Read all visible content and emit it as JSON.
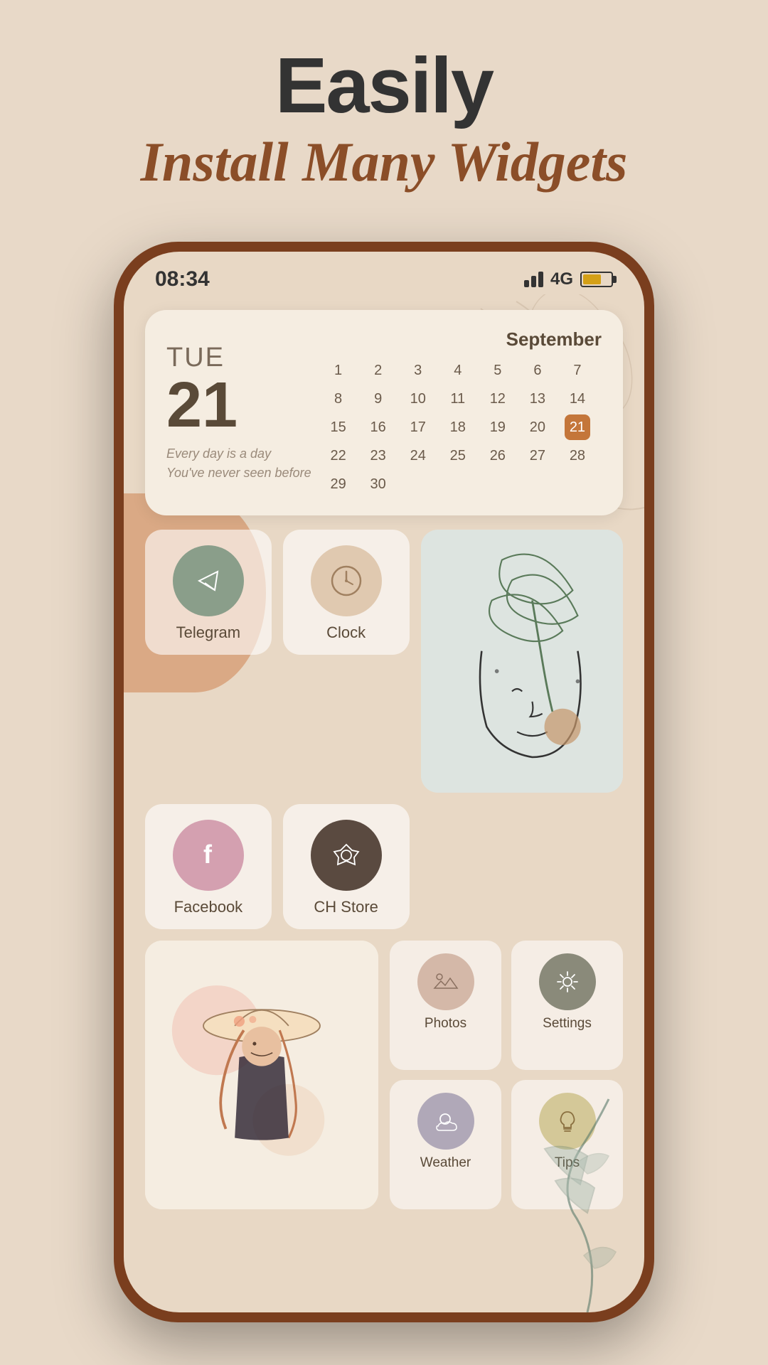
{
  "header": {
    "easily_label": "Easily",
    "subtitle_label": "Install Many Widgets"
  },
  "status_bar": {
    "time": "08:34",
    "network": "4G"
  },
  "calendar_widget": {
    "day_name": "TUE",
    "day_number": "21",
    "month": "September",
    "quote_line1": "Every day is a day",
    "quote_line2": "You've never seen before",
    "today_date": 21,
    "days": [
      {
        "label": "1"
      },
      {
        "label": "2"
      },
      {
        "label": "3"
      },
      {
        "label": "4"
      },
      {
        "label": "5"
      },
      {
        "label": "6"
      },
      {
        "label": "7"
      },
      {
        "label": "8"
      },
      {
        "label": "9"
      },
      {
        "label": "10"
      },
      {
        "label": "11"
      },
      {
        "label": "12"
      },
      {
        "label": "13"
      },
      {
        "label": "14"
      },
      {
        "label": "15"
      },
      {
        "label": "16"
      },
      {
        "label": "17"
      },
      {
        "label": "18"
      },
      {
        "label": "19"
      },
      {
        "label": "20"
      },
      {
        "label": "21"
      },
      {
        "label": "22"
      },
      {
        "label": "23"
      },
      {
        "label": "24"
      },
      {
        "label": "25"
      },
      {
        "label": "26"
      },
      {
        "label": "27"
      },
      {
        "label": "28"
      },
      {
        "label": "29"
      },
      {
        "label": "30"
      }
    ]
  },
  "apps": {
    "telegram": {
      "label": "Telegram"
    },
    "clock": {
      "label": "Clock"
    },
    "facebook": {
      "label": "Facebook"
    },
    "ch_store": {
      "label": "CH Store"
    },
    "photos": {
      "label": "Photos"
    },
    "settings": {
      "label": "Settings"
    },
    "weather": {
      "label": "Weather"
    },
    "tips": {
      "label": "Tips"
    }
  }
}
